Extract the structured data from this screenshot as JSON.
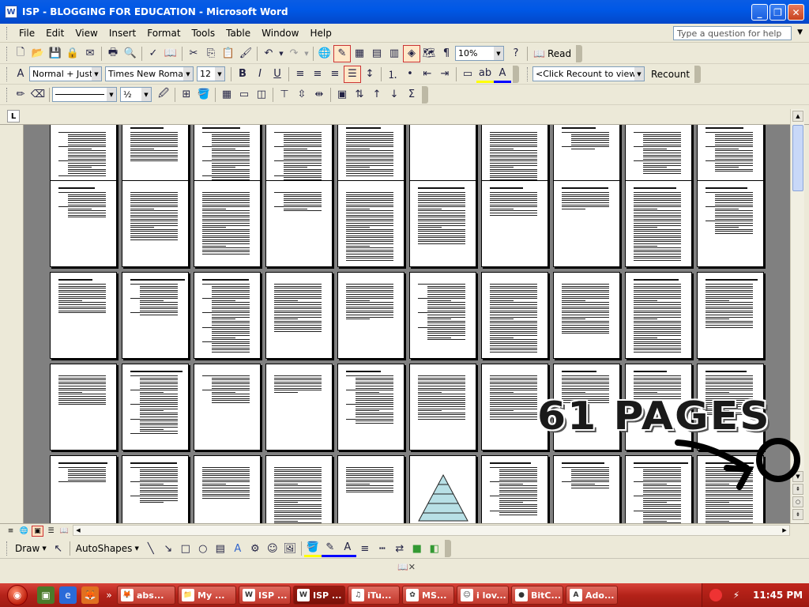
{
  "window": {
    "title": "ISP - BLOGGING FOR EDUCATION - Microsoft Word"
  },
  "menu": [
    "File",
    "Edit",
    "View",
    "Insert",
    "Format",
    "Tools",
    "Table",
    "Window",
    "Help"
  ],
  "help": {
    "placeholder": "Type a question for help"
  },
  "standard_toolbar": {
    "zoom": "10%",
    "read_label": "Read"
  },
  "formatting_toolbar": {
    "style": "Normal + Justif",
    "font": "Times New Roman",
    "size": "12",
    "recount_combo": "<Click Recount to view>",
    "recount_button": "Recount"
  },
  "tables_toolbar": {
    "line_weight": "½"
  },
  "draw_toolbar": {
    "draw_label": "Draw",
    "autoshapes_label": "AutoShapes"
  },
  "annotation": {
    "text": "61 PAGES"
  },
  "taskbar": {
    "tasks": [
      {
        "icon": "firefox-icon",
        "label": "abs..."
      },
      {
        "icon": "folder-icon",
        "label": "My ..."
      },
      {
        "icon": "word-icon",
        "label": "ISP ..."
      },
      {
        "icon": "word-icon",
        "label": "ISP ...",
        "active": true
      },
      {
        "icon": "itunes-icon",
        "label": "iTu..."
      },
      {
        "icon": "msn-icon",
        "label": "MS..."
      },
      {
        "icon": "chat-icon",
        "label": "i lov..."
      },
      {
        "icon": "bitcomet-icon",
        "label": "BitC..."
      },
      {
        "icon": "adobe-icon",
        "label": "Ado..."
      }
    ],
    "clock": "11:45 PM"
  },
  "colors": {
    "titlebar": "#0058e6",
    "taskbar": "#b42219",
    "selected_border": "#cc3333"
  }
}
